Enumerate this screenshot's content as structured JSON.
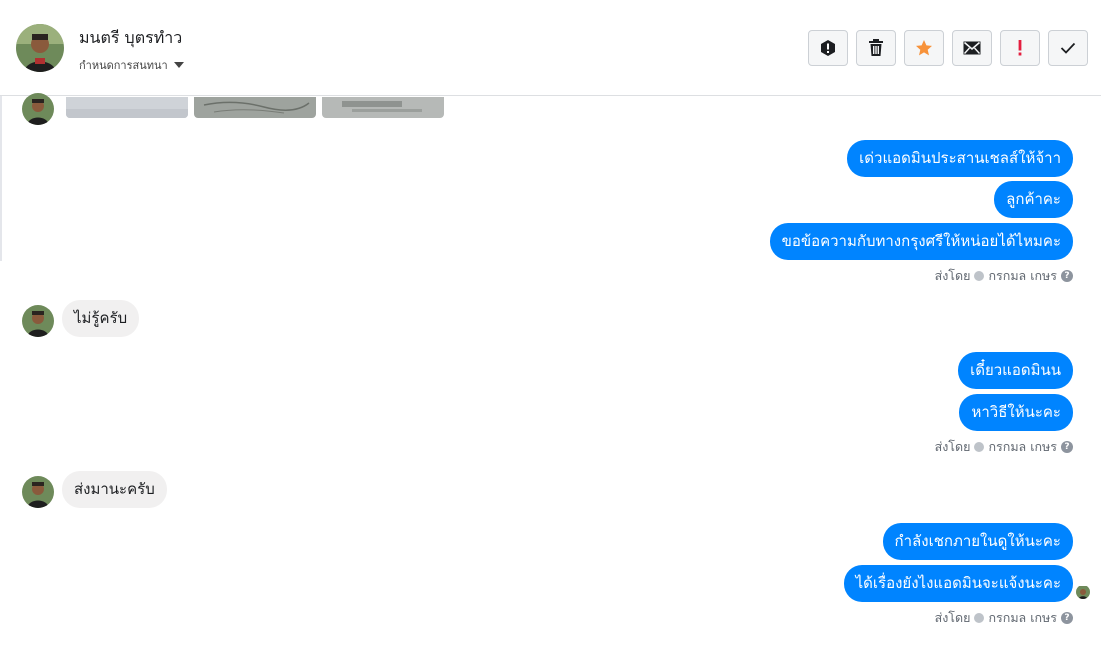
{
  "header": {
    "contact_name": "มนตรี บุตรทำว",
    "assign_label": "กำหนดการสนทนา",
    "actions": [
      {
        "name": "mark-spam-button",
        "icon": "exclamation-circle-icon"
      },
      {
        "name": "delete-button",
        "icon": "trash-icon"
      },
      {
        "name": "star-button",
        "icon": "star-icon"
      },
      {
        "name": "mark-unread-button",
        "icon": "envelope-icon"
      },
      {
        "name": "follow-up-button",
        "icon": "exclamation-icon"
      },
      {
        "name": "mark-done-button",
        "icon": "check-icon"
      }
    ]
  },
  "colors": {
    "outgoing_bubble": "#0084ff",
    "incoming_bubble": "#f1f0f0",
    "star": "#f7923a",
    "follow_up": "#e41e3f"
  },
  "messages": {
    "group1": [
      "เด่วแอดมินประสานเชลส์ให้จ้าา",
      "ลูกค้าคะ",
      "ขอข้อความกับทางกรุงศรีให้หน่อยได้ไหมคะ"
    ],
    "incoming1": "ไม่รู้ครับ",
    "group2": [
      "เดี๋ยวแอดมินน",
      "หาวิธีให้นะคะ"
    ],
    "incoming2": "ส่งมานะครับ",
    "group3": [
      "กำลังเชกภายในดูให้นะคะ",
      "ได้เรื่องยังไงแอดมินจะแจ้งนะคะ"
    ]
  },
  "sent_by": {
    "prefix": "ส่งโดย",
    "agent": "กรกมล เกษร",
    "help": "?"
  }
}
